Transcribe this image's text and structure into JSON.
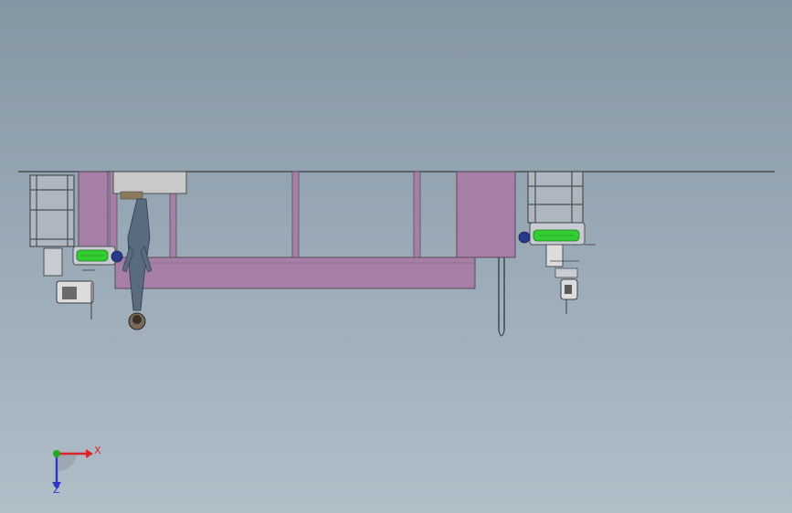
{
  "viewport": {
    "background_top": "#8596a3",
    "background_bottom": "#b0bec8"
  },
  "colors": {
    "beam_fill": "#a67fa6",
    "beam_edge": "#5a4a5e",
    "frame_line": "#4a4f55",
    "frame_fill": "#c8ccd2",
    "light_panel": "#c9c9c9",
    "motor_green": "#33cc33",
    "motor_blue": "#2a3a8a",
    "rail_line": "#3a3f45",
    "figure_cloth": "#5a6b80",
    "figure_skin": "#7a6a5a"
  },
  "triad": {
    "x_label": "X",
    "z_label": "Z",
    "x_color": "#d8262a",
    "y_color": "#22aa22",
    "z_color": "#2a36c8"
  },
  "icons": {
    "triad": "coordinate-triad-icon"
  }
}
